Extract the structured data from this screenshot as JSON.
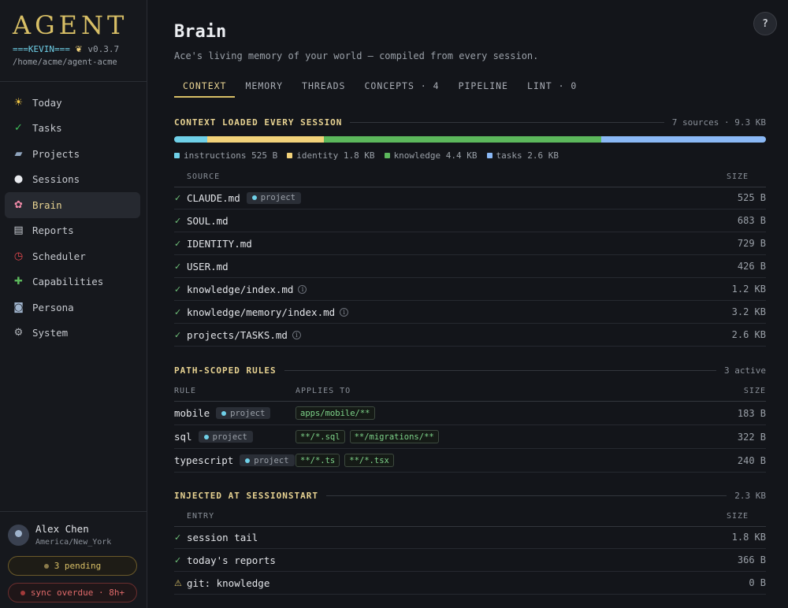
{
  "app": {
    "logo": "AGENT",
    "tag": "===KEVIN===",
    "version": "v0.3.7",
    "home_path": "/home/acme/agent-acme"
  },
  "sidebar": {
    "items": [
      {
        "label": "Today",
        "icon": "sun-icon",
        "glyph": "☀",
        "color": "#f2c744"
      },
      {
        "label": "Tasks",
        "icon": "check-box-icon",
        "glyph": "✓",
        "color": "#3fbf5a"
      },
      {
        "label": "Projects",
        "icon": "folder-icon",
        "glyph": "▰",
        "color": "#8fa4bd"
      },
      {
        "label": "Sessions",
        "icon": "speech-bubble-icon",
        "glyph": "●",
        "color": "#e8eaee"
      },
      {
        "label": "Brain",
        "icon": "brain-icon",
        "glyph": "✿",
        "color": "#f08aa8",
        "active": true
      },
      {
        "label": "Reports",
        "icon": "newspaper-icon",
        "glyph": "▤",
        "color": "#c8ccd2"
      },
      {
        "label": "Scheduler",
        "icon": "alarm-clock-icon",
        "glyph": "◷",
        "color": "#e5484d"
      },
      {
        "label": "Capabilities",
        "icon": "puzzle-icon",
        "glyph": "✚",
        "color": "#5cb85c"
      },
      {
        "label": "Persona",
        "icon": "robot-icon",
        "glyph": "◙",
        "color": "#9fb3cc"
      },
      {
        "label": "System",
        "icon": "gear-icon",
        "glyph": "⚙",
        "color": "#b0b4ba"
      }
    ]
  },
  "user": {
    "name": "Alex Chen",
    "timezone": "America/New_York"
  },
  "status": {
    "pending": "3 pending",
    "sync": "sync overdue · 8h+"
  },
  "page": {
    "title": "Brain",
    "subtitle": "Ace's living memory of your world — compiled from every session.",
    "help": "?"
  },
  "tabs": [
    {
      "label": "CONTEXT",
      "active": true
    },
    {
      "label": "MEMORY"
    },
    {
      "label": "THREADS"
    },
    {
      "label": "CONCEPTS · 4"
    },
    {
      "label": "PIPELINE"
    },
    {
      "label": "LINT · 0"
    }
  ],
  "context": {
    "title": "CONTEXT LOADED EVERY SESSION",
    "meta": "7 sources · 9.3 KB",
    "breakdown": [
      {
        "label": "instructions 525 B",
        "bytes": 525,
        "color": "#6fd0e8"
      },
      {
        "label": "identity 1.8 KB",
        "bytes": 1838,
        "color": "#f2d27a"
      },
      {
        "label": "knowledge 4.4 KB",
        "bytes": 4400,
        "color": "#5cb85c"
      },
      {
        "label": "tasks 2.6 KB",
        "bytes": 2600,
        "color": "#8ab8f5"
      }
    ],
    "col_source": "SOURCE",
    "col_size": "SIZE",
    "rows": [
      {
        "name": "CLAUDE.md",
        "badge": "project",
        "size": "525 B"
      },
      {
        "name": "SOUL.md",
        "size": "683 B"
      },
      {
        "name": "IDENTITY.md",
        "size": "729 B"
      },
      {
        "name": "USER.md",
        "size": "426 B"
      },
      {
        "name": "knowledge/index.md",
        "info": "i",
        "size": "1.2 KB"
      },
      {
        "name": "knowledge/memory/index.md",
        "info": "i",
        "size": "3.2 KB"
      },
      {
        "name": "projects/TASKS.md",
        "info": "i",
        "size": "2.6 KB"
      }
    ]
  },
  "rules": {
    "title": "PATH-SCOPED RULES",
    "meta": "3 active",
    "col_rule": "RULE",
    "col_applies": "APPLIES TO",
    "col_size": "SIZE",
    "rows": [
      {
        "name": "mobile",
        "badge": "project",
        "globs": [
          "apps/mobile/**"
        ],
        "size": "183 B"
      },
      {
        "name": "sql",
        "badge": "project",
        "globs": [
          "**/*.sql",
          "**/migrations/**"
        ],
        "size": "322 B"
      },
      {
        "name": "typescript",
        "badge": "project",
        "globs": [
          "**/*.ts",
          "**/*.tsx"
        ],
        "size": "240 B"
      }
    ]
  },
  "injected": {
    "title": "INJECTED AT SESSIONSTART",
    "meta": "2.3 KB",
    "col_entry": "ENTRY",
    "col_size": "SIZE",
    "rows": [
      {
        "name": "session tail",
        "status": "ok",
        "size": "1.8 KB"
      },
      {
        "name": "today's reports",
        "status": "ok",
        "size": "366 B"
      },
      {
        "name": "git: knowledge",
        "status": "warn",
        "size": "0 B"
      }
    ]
  }
}
